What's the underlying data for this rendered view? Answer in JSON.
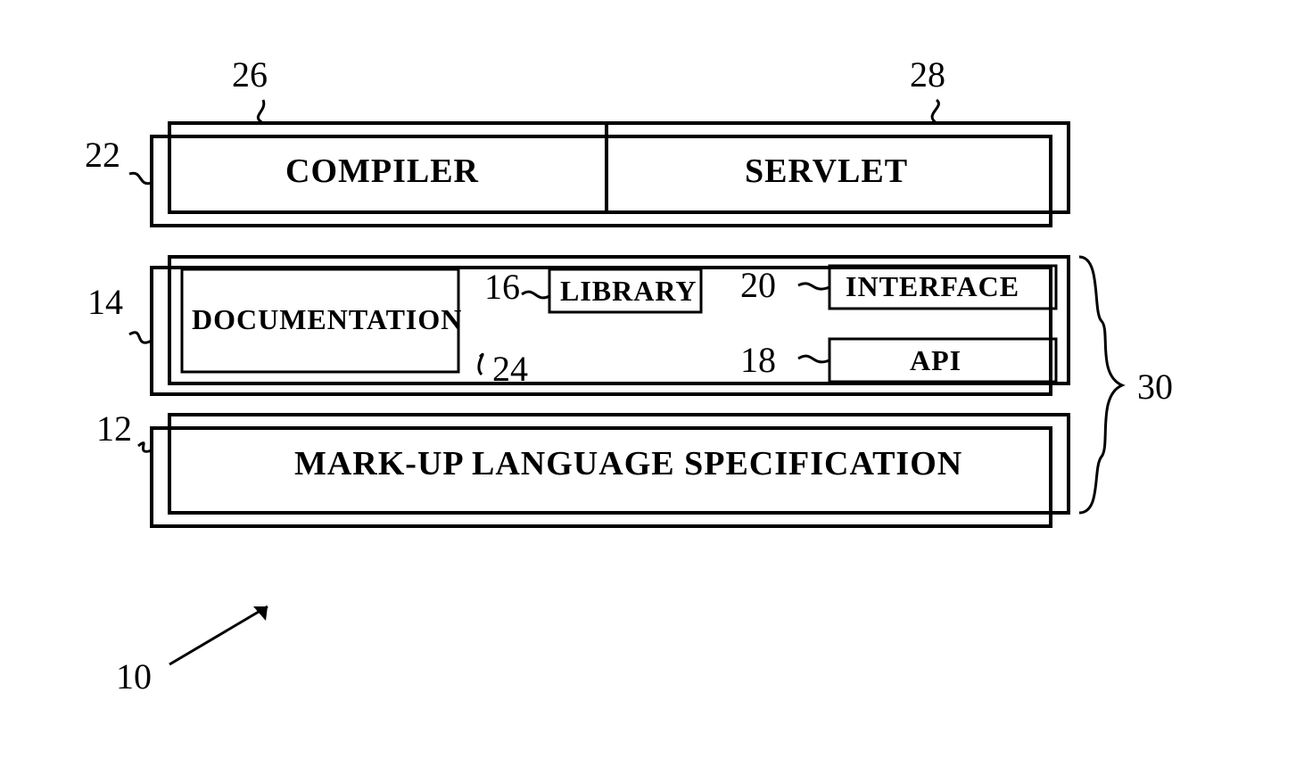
{
  "labels": {
    "n10": "10",
    "n12": "12",
    "n14": "14",
    "n16": "16",
    "n18": "18",
    "n20": "20",
    "n22": "22",
    "n24": "24",
    "n26": "26",
    "n28": "28",
    "n30": "30"
  },
  "boxes": {
    "compiler": "COMPILER",
    "servlet": "SERVLET",
    "documentation": "DOCUMENTATION",
    "library": "LIBRARY",
    "interface": "INTERFACE",
    "api": "API",
    "markup": "MARK-UP LANGUAGE SPECIFICATION"
  }
}
